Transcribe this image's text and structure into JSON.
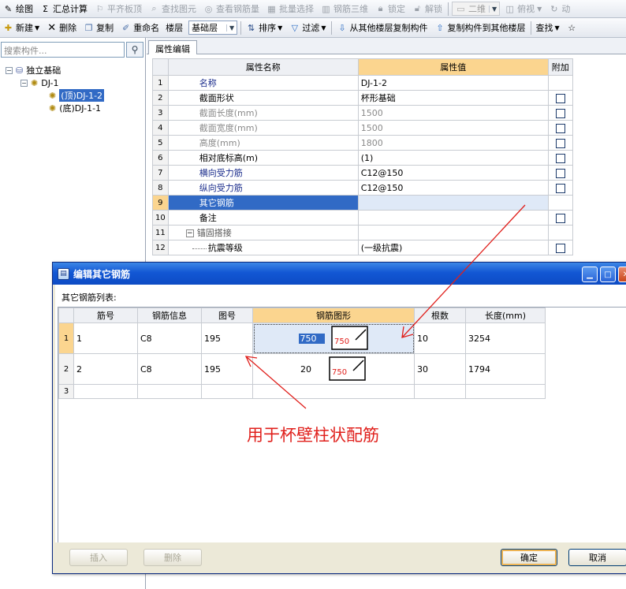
{
  "toolbar_main": {
    "items": [
      {
        "icon": "pencil-icon",
        "label": "绘图",
        "enabled": true
      },
      {
        "icon": "sigma-icon",
        "label": "汇总计算",
        "enabled": true
      },
      {
        "icon": "flag-icon",
        "label": "平齐板顶",
        "enabled": false
      },
      {
        "icon": "search-figure-icon",
        "label": "查找图元",
        "enabled": false
      },
      {
        "icon": "view-rebar-icon",
        "label": "查看钢筋量",
        "enabled": false
      },
      {
        "icon": "batch-select-icon",
        "label": "批量选择",
        "enabled": false
      },
      {
        "icon": "rebar-3d-icon",
        "label": "钢筋三维",
        "enabled": false
      },
      {
        "icon": "lock-icon",
        "label": "锁定",
        "enabled": false
      },
      {
        "icon": "unlock-icon",
        "label": "解锁",
        "enabled": false
      }
    ],
    "view_mode": "二维",
    "view_label": "俯视",
    "dynamic_label": "动"
  },
  "toolbar_component": {
    "new_label": "新建",
    "delete_label": "删除",
    "copy_label": "复制",
    "rename_label": "重命名",
    "floor_label": "楼层",
    "floor_value": "基础层",
    "sort_label": "排序",
    "filter_label": "过滤",
    "copy_from_other_label": "从其他楼层复制构件",
    "copy_to_other_label": "复制构件到其他楼层",
    "find_label": "查找"
  },
  "component_panel": {
    "search_placeholder": "搜索构件...",
    "tree": [
      {
        "label": "独立基础",
        "level": 0
      },
      {
        "label": "DJ-1",
        "level": 1
      },
      {
        "label": "(顶)DJ-1-2",
        "level": 2,
        "selected": true
      },
      {
        "label": "(底)DJ-1-1",
        "level": 2,
        "selected": false
      }
    ]
  },
  "property_editor": {
    "tab_label": "属性编辑",
    "headers": {
      "name": "属性名称",
      "value": "属性值",
      "extra": "附加"
    },
    "rows": [
      {
        "num": "1",
        "name": "名称",
        "value": "DJ-1-2",
        "style": "blue",
        "check": false
      },
      {
        "num": "2",
        "name": "截面形状",
        "value": "杯形基础",
        "style": "normal",
        "check": true
      },
      {
        "num": "3",
        "name": "截面长度(mm)",
        "value": "1500",
        "style": "gray",
        "check": true
      },
      {
        "num": "4",
        "name": "截面宽度(mm)",
        "value": "1500",
        "style": "gray",
        "check": true
      },
      {
        "num": "5",
        "name": "高度(mm)",
        "value": "1800",
        "style": "gray",
        "check": true
      },
      {
        "num": "6",
        "name": "相对底标高(m)",
        "value": "(1)",
        "style": "normal",
        "check": true
      },
      {
        "num": "7",
        "name": "横向受力筋",
        "value": "C12@150",
        "style": "blue",
        "check": true
      },
      {
        "num": "8",
        "name": "纵向受力筋",
        "value": "C12@150",
        "style": "blue",
        "check": true
      },
      {
        "num": "9",
        "name": "其它钢筋",
        "value": "",
        "style": "selected",
        "check": false
      },
      {
        "num": "10",
        "name": "备注",
        "value": "",
        "style": "normal",
        "check": true
      },
      {
        "num": "11",
        "name": "锚固搭接",
        "value": "",
        "style": "group",
        "check": false
      },
      {
        "num": "12",
        "name": "抗震等级",
        "value": "(一级抗震)",
        "style": "child",
        "check": true
      }
    ]
  },
  "dialog": {
    "title": "编辑其它钢筋",
    "list_label": "其它钢筋列表:",
    "headers": [
      "筋号",
      "钢筋信息",
      "图号",
      "钢筋图形",
      "根数",
      "长度(mm)"
    ],
    "rows": [
      {
        "num": "1",
        "bar_no": "1",
        "info": "C8",
        "figure_no": "195",
        "shape_value": "750",
        "shape_label": "750",
        "count": "10",
        "length": "3254",
        "editing": true
      },
      {
        "num": "2",
        "bar_no": "2",
        "info": "C8",
        "figure_no": "195",
        "shape_value": "20",
        "shape_label": "750",
        "count": "30",
        "length": "1794",
        "editing": false
      },
      {
        "num": "3",
        "bar_no": "",
        "info": "",
        "figure_no": "",
        "shape_value": "",
        "shape_label": "",
        "count": "",
        "length": "",
        "editing": false
      }
    ],
    "buttons": {
      "insert": "插入",
      "delete": "删除",
      "ok": "确定",
      "cancel": "取消"
    }
  },
  "annotation": {
    "text": "用于杯壁柱状配筋",
    "color": "#e0201c"
  }
}
